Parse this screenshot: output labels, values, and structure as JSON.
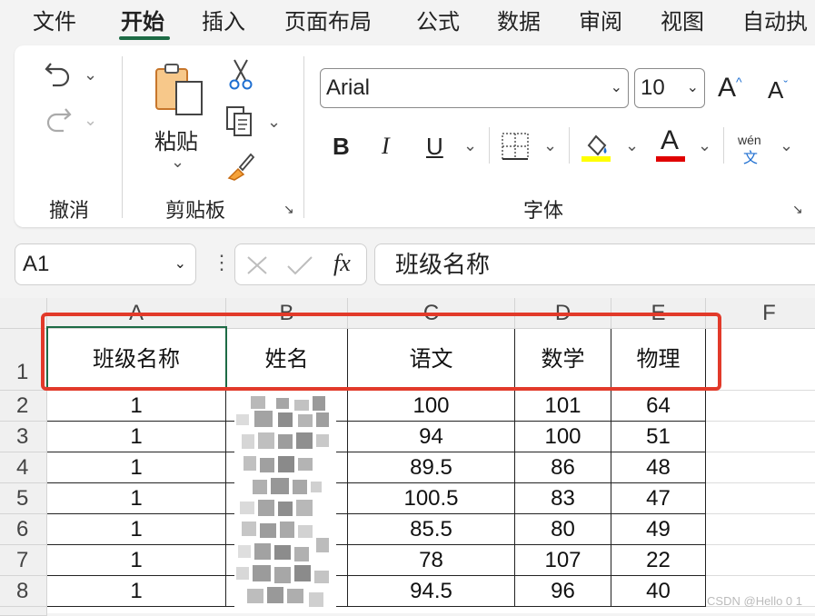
{
  "menu": {
    "tabs": [
      "文件",
      "开始",
      "插入",
      "页面布局",
      "公式",
      "数据",
      "审阅",
      "视图",
      "自动执"
    ],
    "active": "开始"
  },
  "ribbon": {
    "groups": {
      "undo": "撤消",
      "clipboard": "剪贴板",
      "font": "字体"
    },
    "paste_label": "粘贴",
    "font_name": "Arial",
    "font_size": "10",
    "bold": "B",
    "italic": "I",
    "underline": "U",
    "font_color_glyph": "A",
    "grow_font": "A",
    "shrink_font": "A",
    "phonetic_top": "wén",
    "phonetic_bottom": "文",
    "fill_color": "#ffff00",
    "font_color": "#e00000"
  },
  "formula_bar": {
    "name_box": "A1",
    "fx": "fx",
    "content": "班级名称"
  },
  "sheet": {
    "columns": [
      "A",
      "B",
      "C",
      "D",
      "E",
      "F"
    ],
    "rows": [
      "1",
      "2",
      "3",
      "4",
      "5",
      "6",
      "7",
      "8"
    ],
    "header": [
      "班级名称",
      "姓名",
      "语文",
      "数学",
      "物理"
    ],
    "data": [
      [
        "1",
        "",
        "100",
        "101",
        "64"
      ],
      [
        "1",
        "",
        "94",
        "100",
        "51"
      ],
      [
        "1",
        "",
        "89.5",
        "86",
        "48"
      ],
      [
        "1",
        "",
        "100.5",
        "83",
        "47"
      ],
      [
        "1",
        "",
        "85.5",
        "80",
        "49"
      ],
      [
        "1",
        "",
        "78",
        "107",
        "22"
      ],
      [
        "1",
        "",
        "94.5",
        "96",
        "40"
      ]
    ]
  },
  "watermark": "CSDN @Hello 0 1"
}
